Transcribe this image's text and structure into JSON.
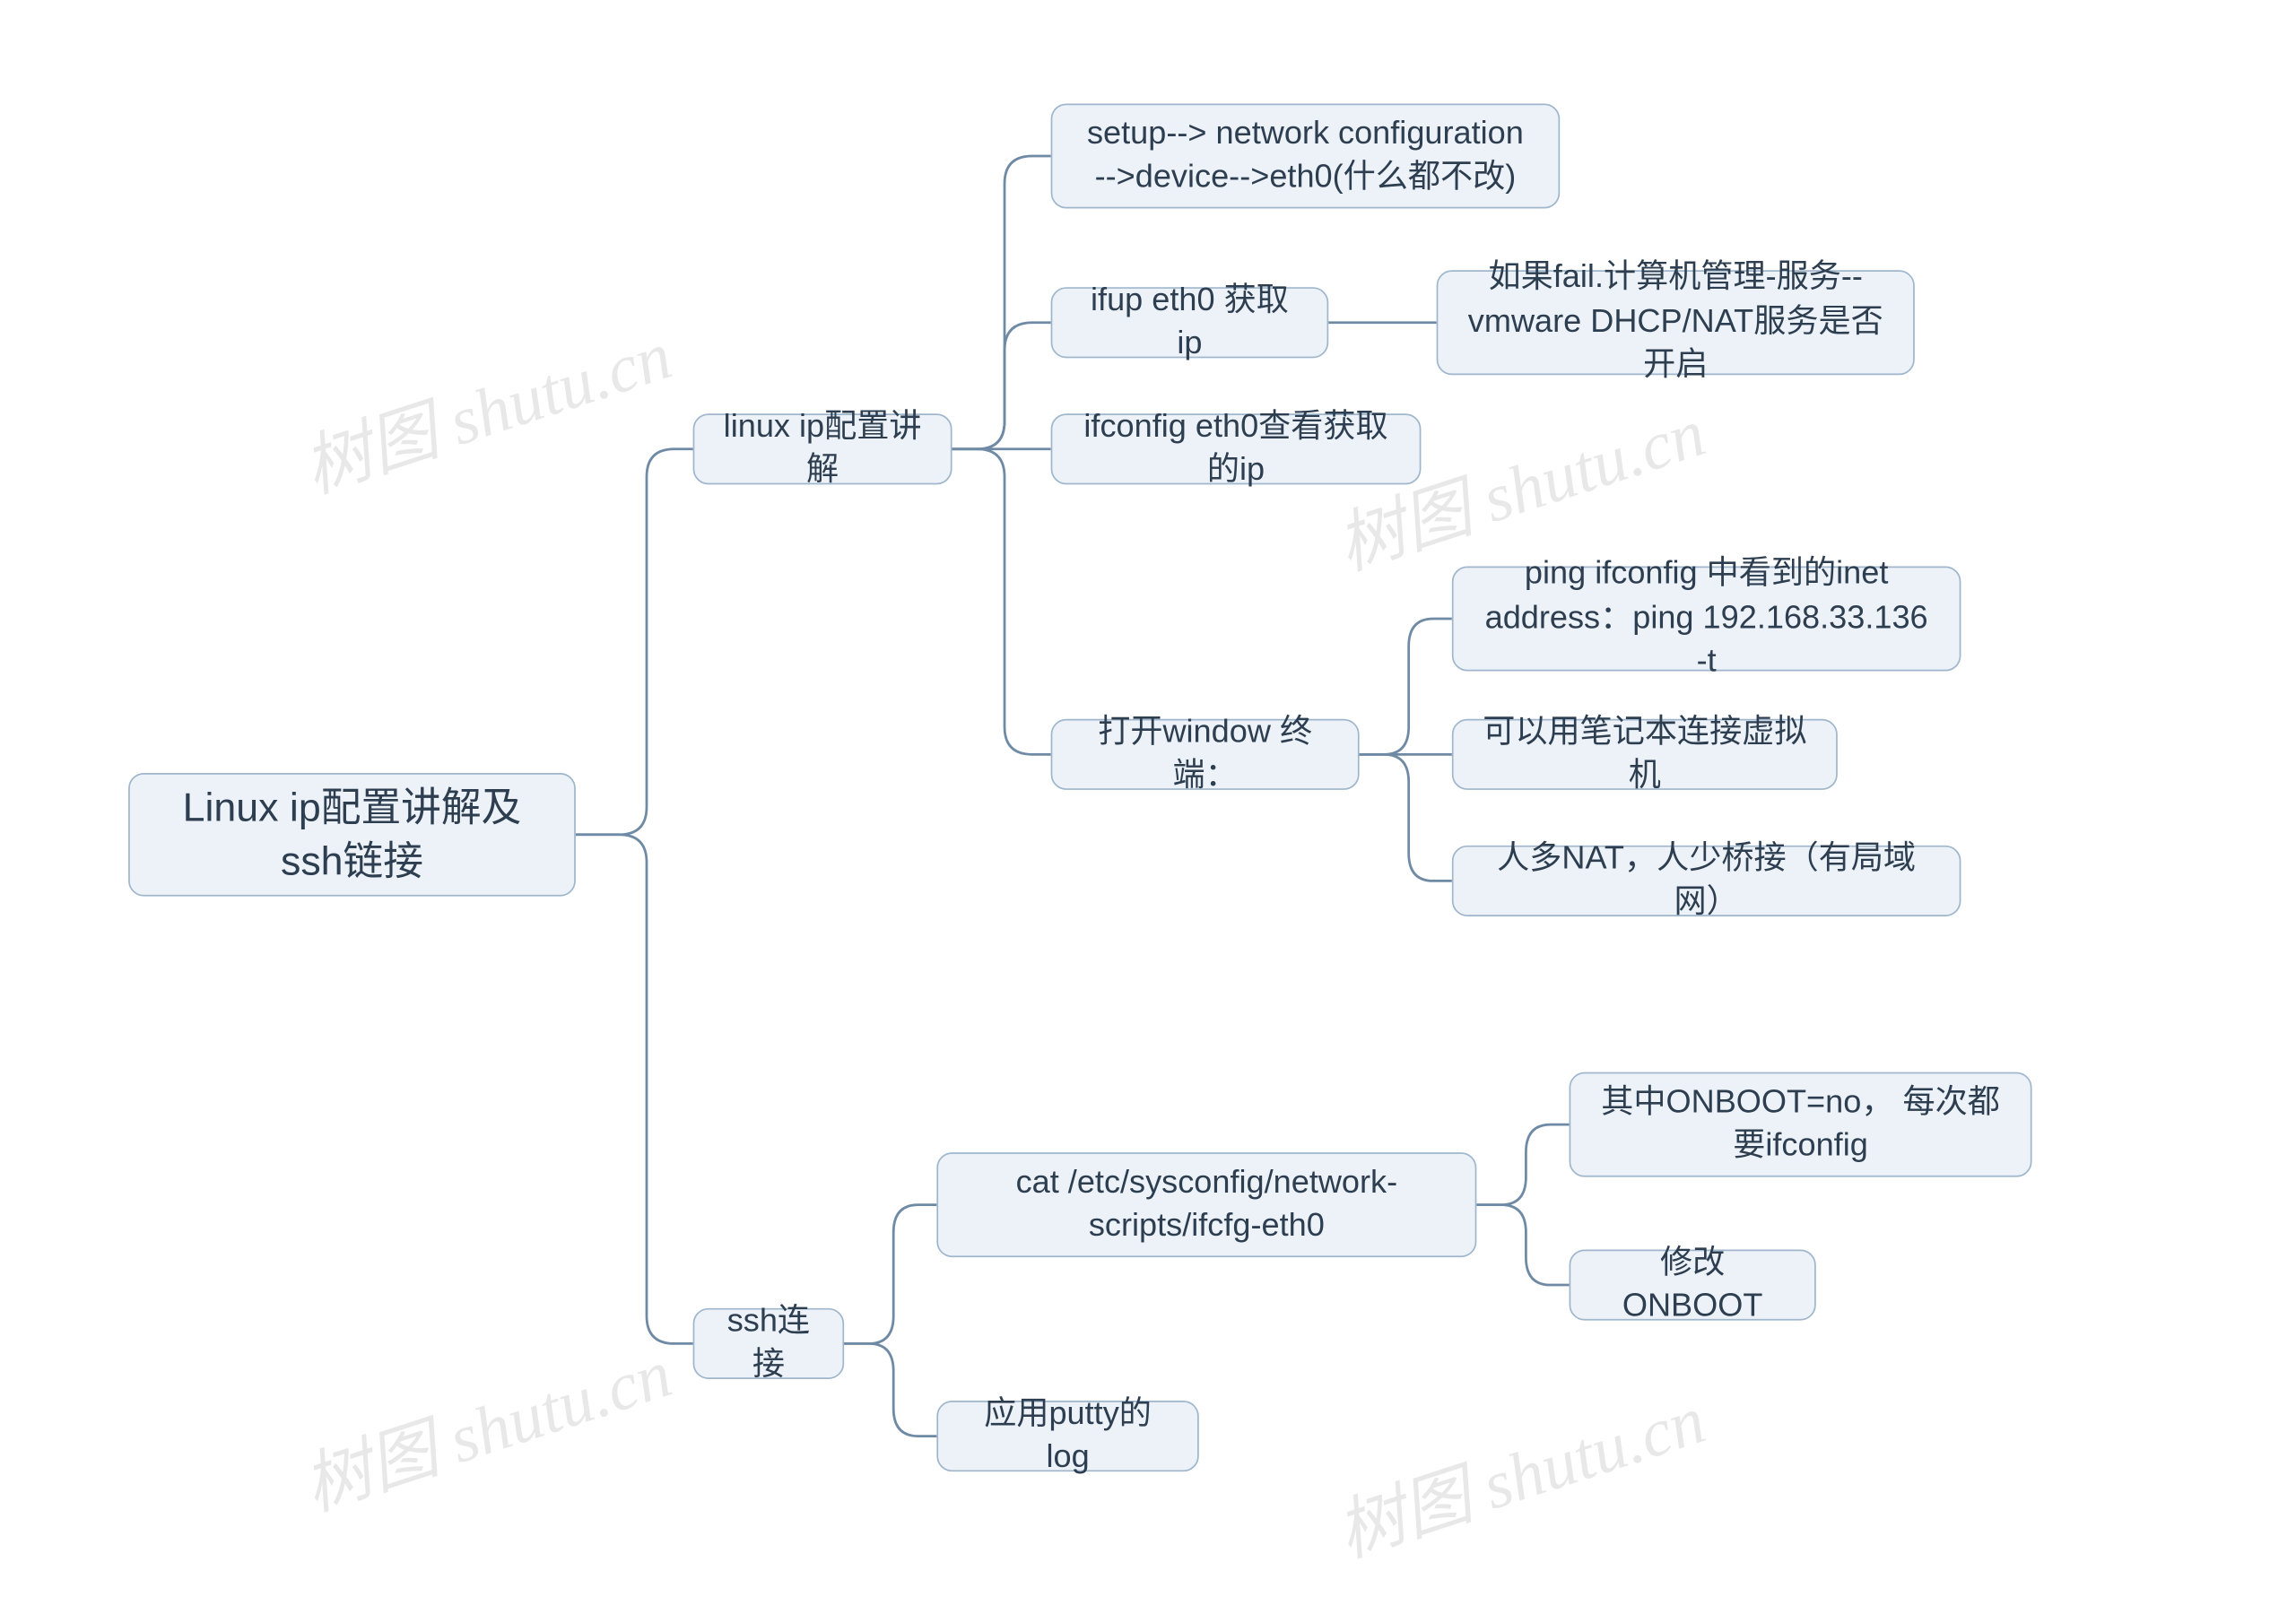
{
  "watermark": "树图 shutu.cn",
  "root": {
    "label": "Linux ip配置讲解及ssh链接"
  },
  "branches": [
    {
      "key": "ipconfig",
      "label": "linux ip配置讲解",
      "children": [
        {
          "key": "setup",
          "label": "setup--> network configuration -->device-->eth0(什么都不改)"
        },
        {
          "key": "ifup",
          "label": "ifup eth0 获取ip",
          "children": [
            {
              "key": "ifup_fail",
              "label": "如果fail.计算机管理-服务--vmware DHCP/NAT服务是否开启"
            }
          ]
        },
        {
          "key": "ifconfig",
          "label": "ifconfig eth0查看获取的ip"
        },
        {
          "key": "winterm",
          "label": "打开window 终端：",
          "children": [
            {
              "key": "ping",
              "label": "ping ifconfig 中看到的inet address：ping 192.168.33.136 -t"
            },
            {
              "key": "laptop",
              "label": "可以用笔记本连接虚拟机"
            },
            {
              "key": "nat",
              "label": "人多NAT，人少桥接（有局域网）"
            }
          ]
        }
      ]
    },
    {
      "key": "ssh",
      "label": "ssh连接",
      "children": [
        {
          "key": "cat",
          "label": "cat /etc/sysconfig/network-scripts/ifcfg-eth0",
          "children": [
            {
              "key": "onboot_no",
              "label": "其中ONBOOT=no， 每次都要ifconfig"
            },
            {
              "key": "onboot_mod",
              "label": "修改ONBOOT"
            }
          ]
        },
        {
          "key": "putty",
          "label": "应用putty的log"
        }
      ]
    }
  ]
}
